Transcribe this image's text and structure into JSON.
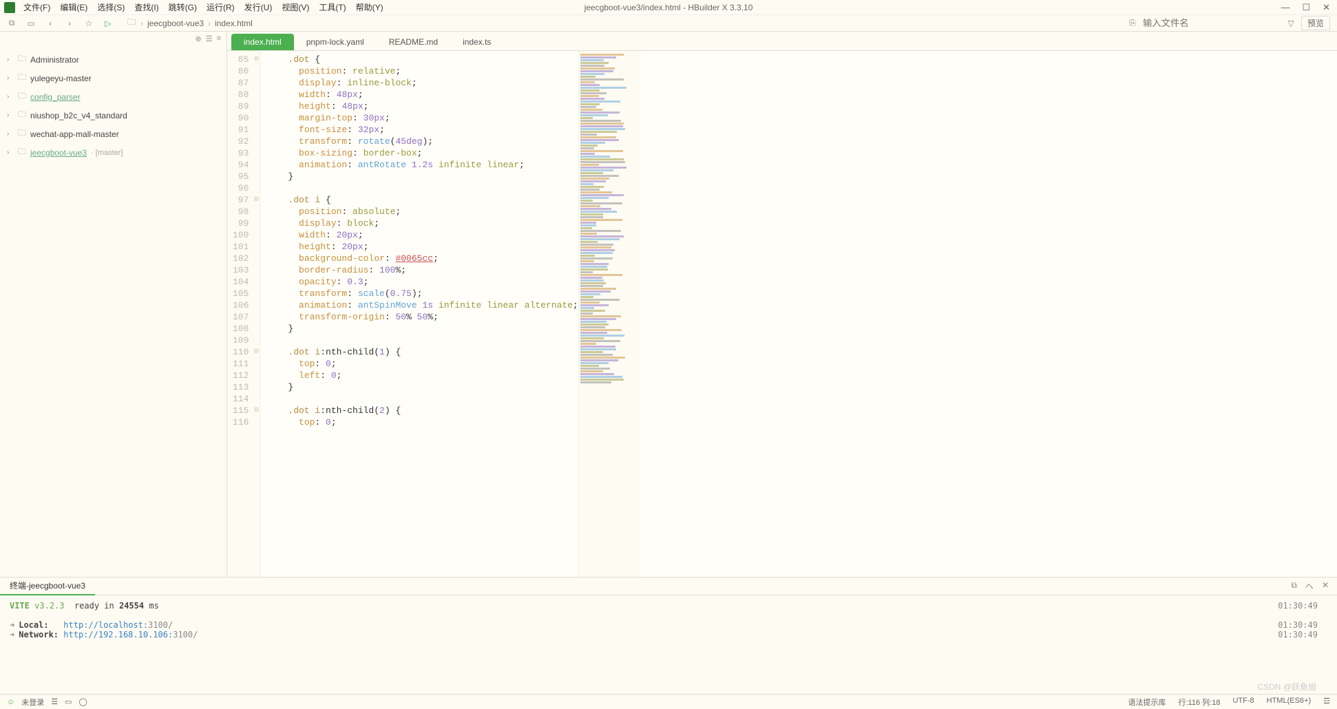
{
  "window": {
    "title": "jeecgboot-vue3/index.html - HBuilder X 3.3.10"
  },
  "menubar": [
    "文件(F)",
    "编辑(E)",
    "选择(S)",
    "查找(I)",
    "跳转(G)",
    "运行(R)",
    "发行(U)",
    "视图(V)",
    "工具(T)",
    "帮助(Y)"
  ],
  "toolbar": {
    "search_placeholder": "输入文件名",
    "preview_label": "预览"
  },
  "breadcrumb": [
    "jeecgboot-vue3",
    "index.html"
  ],
  "sidebar": {
    "items": [
      {
        "name": "Administrator",
        "linked": false
      },
      {
        "name": "yulegeyu-master",
        "linked": false
      },
      {
        "name": "config_parser",
        "linked": true
      },
      {
        "name": "niushop_b2c_v4_standard",
        "linked": false
      },
      {
        "name": "wechat-app-mall-master",
        "linked": false
      },
      {
        "name": "jeecgboot-vue3",
        "linked": true,
        "branch": "[master]"
      }
    ]
  },
  "tabs": [
    {
      "label": "index.html",
      "active": true
    },
    {
      "label": "pnpm-lock.yaml",
      "active": false
    },
    {
      "label": "README.md",
      "active": false
    },
    {
      "label": "index.ts",
      "active": false
    }
  ],
  "code": {
    "first_line": 85,
    "lines": [
      ".dot {",
      "  position: relative;",
      "  display: inline-block;",
      "  width: 48px;",
      "  height: 48px;",
      "  margin-top: 30px;",
      "  font-size: 32px;",
      "  transform: rotate(45deg);",
      "  box-sizing: border-box;",
      "  animation: antRotate 1.2s infinite linear;",
      "}",
      "",
      ".dot i {",
      "  position: absolute;",
      "  display: block;",
      "  width: 20px;",
      "  height: 20px;",
      "  background-color: #0065cc;",
      "  border-radius: 100%;",
      "  opacity: 0.3;",
      "  transform: scale(0.75);",
      "  animation: antSpinMove 1s infinite linear alternate;",
      "  transform-origin: 50% 50%;",
      "}",
      "",
      ".dot i:nth-child(1) {",
      "  top: 0;",
      "  left: 0;",
      "}",
      "",
      ".dot i:nth-child(2) {",
      "  top: 0;"
    ],
    "fold_lines": [
      85,
      97,
      110,
      115
    ]
  },
  "terminal": {
    "tab_label": "终端-jeecgboot-vue3",
    "vite_line_prefix": "VITE",
    "vite_version": "v3.2.3",
    "vite_ready": "ready in",
    "vite_ms": "24554",
    "vite_ms_unit": "ms",
    "local_label": "Local:",
    "local_url": "http://localhost:",
    "local_port": "3100/",
    "network_label": "Network:",
    "network_url": "http://192.168.10.106:",
    "network_port": "3100/",
    "ts1": "01:30:49",
    "ts2": "01:30:49",
    "ts3": "01:30:49"
  },
  "statusbar": {
    "login": "未登录",
    "syntax": "语法提示库",
    "cursor": "行:116  列:18",
    "encoding": "UTF-8",
    "lang": "HTML(ES6+)"
  },
  "watermark": "CSDN @跃鱼旭"
}
